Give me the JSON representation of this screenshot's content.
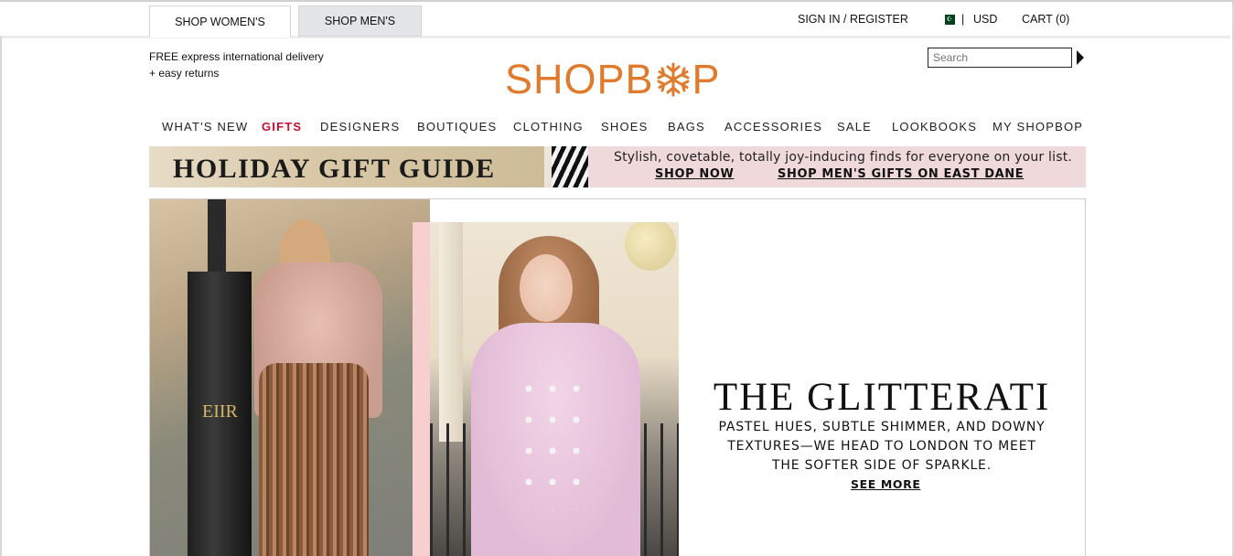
{
  "tabs": {
    "women": "SHOP WOMEN'S",
    "men": "SHOP MEN'S"
  },
  "utility": {
    "sign_in": "SIGN IN / REGISTER",
    "separator": "|",
    "currency": "USD",
    "cart": "CART (0)",
    "flag_icon": "pakistan-flag-icon"
  },
  "promo": {
    "line1": "FREE express international delivery",
    "line2": "+ easy returns"
  },
  "logo": {
    "text_left": "SHOPB",
    "text_right": "P",
    "icon": "snowflake-icon",
    "color": "#e07b2d"
  },
  "search": {
    "placeholder": "Search",
    "value": ""
  },
  "nav": [
    "WHAT'S NEW",
    "GIFTS",
    "DESIGNERS",
    "BOUTIQUES",
    "CLOTHING",
    "SHOES",
    "BAGS",
    "ACCESSORIES",
    "SALE",
    "LOOKBOOKS",
    "MY SHOPBOP"
  ],
  "banner": {
    "title": "HOLIDAY GIFT GUIDE",
    "subtitle": "Stylish, covetable, totally joy-inducing finds for everyone on your list.",
    "shop_now": "SHOP NOW",
    "shop_men": "SHOP MEN'S GIFTS ON EAST DANE"
  },
  "hero": {
    "title": "THE GLITTERATI",
    "description_1": "PASTEL HUES, SUBTLE SHIMMER, AND DOWNY",
    "description_2": "TEXTURES—WE HEAD TO LONDON TO MEET",
    "description_3": "THE SOFTER SIDE OF SPARKLE.",
    "see_more": "SEE MORE",
    "crest_text": "EIIR"
  },
  "colors": {
    "accent": "#c8102e",
    "banner_pink": "#f0d9da"
  }
}
